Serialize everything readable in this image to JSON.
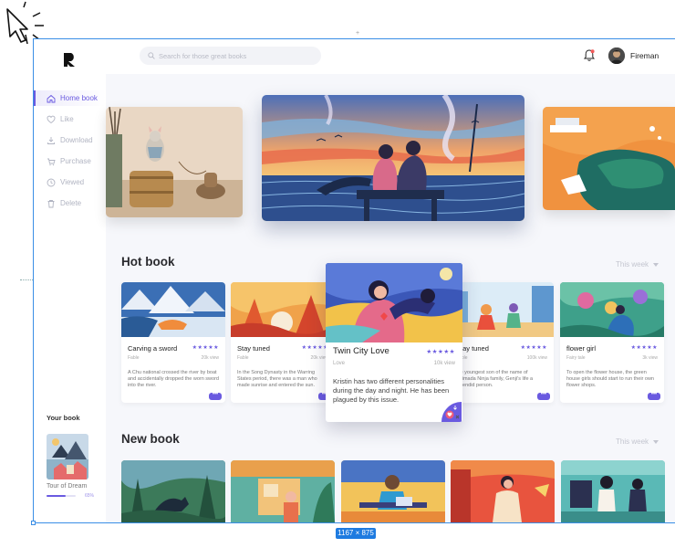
{
  "sidebar": {
    "items": [
      {
        "label": "Home book",
        "icon": "home-icon",
        "active": true
      },
      {
        "label": "Like",
        "icon": "heart-icon"
      },
      {
        "label": "Download",
        "icon": "download-icon"
      },
      {
        "label": "Purchase",
        "icon": "cart-icon"
      },
      {
        "label": "Viewed",
        "icon": "clock-icon"
      },
      {
        "label": "Delete",
        "icon": "trash-icon"
      }
    ],
    "your_book": {
      "title": "Your book",
      "name": "Tour of Dream",
      "progress": 0.65,
      "progress_label": "65%"
    }
  },
  "header": {
    "search_placeholder": "Search for those great books",
    "username": "Fireman"
  },
  "hot_book": {
    "title": "Hot book",
    "filter": "This week",
    "cards": [
      {
        "title": "Carving a sword",
        "stars": "★★★★★",
        "category": "Fable",
        "views": "20k view",
        "desc": "A Chu national crossed the river by boat and accidentally dropped the worn sword into the river.",
        "more": "•••"
      },
      {
        "title": "Stay tuned",
        "stars": "★★★★★",
        "category": "Fable",
        "views": "20k view",
        "desc": "In the Song Dynasty in the Warring States period, there was a man who made sunrise and entered the sun.",
        "more": "•••"
      },
      {
        "title": "Stay tuned",
        "stars": "★★★★★",
        "category": "Fable",
        "views": "100k view",
        "desc": "the youngest son of the name of Shimada Ninja family, Genji's life a splendid person.",
        "more": "•••"
      },
      {
        "title": "flower girl",
        "stars": "★★★★★",
        "category": "Fairy tale",
        "views": "3k view",
        "desc": "To open the flower house, the green house girls should start to run their own flower shops.",
        "more": "•••"
      }
    ],
    "expanded": {
      "title": "Twin City Love",
      "stars": "★★★★★",
      "category": "Love",
      "views": "10k view",
      "desc": "Kristin has two different personalities during the day and night. He has been plagued by this issue."
    }
  },
  "new_book": {
    "title": "New book",
    "filter": "This week"
  },
  "editor": {
    "size_label": "1167 × 875"
  },
  "colors": {
    "accent": "#6a5ae0",
    "selection": "#3a8ee6"
  }
}
